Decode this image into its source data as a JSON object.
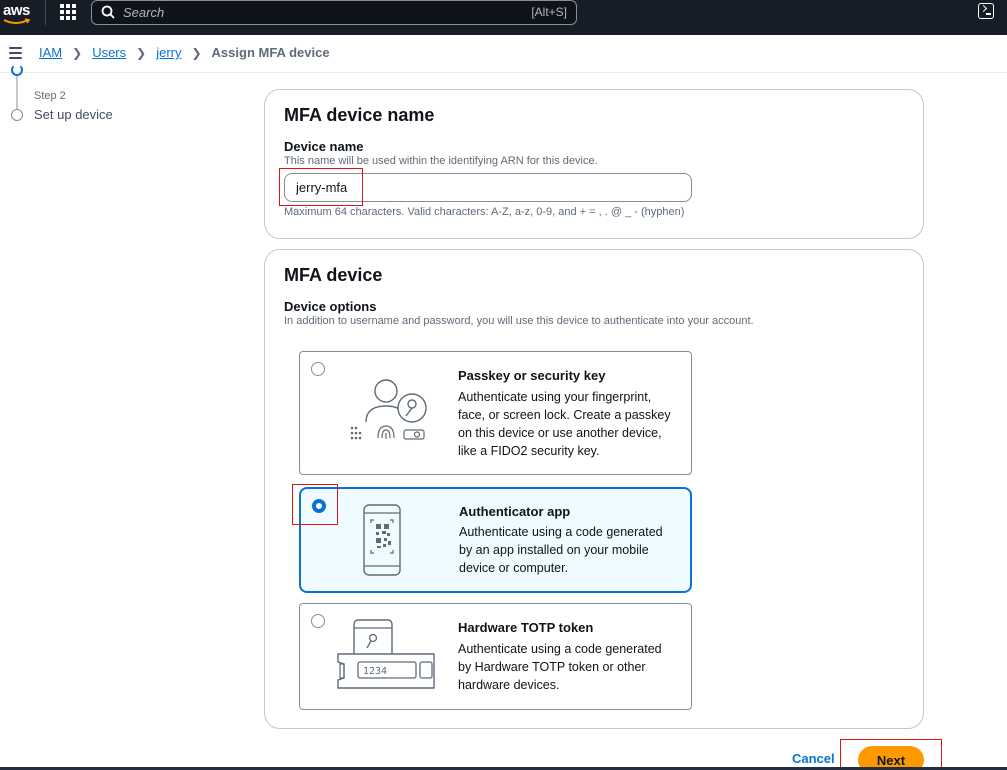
{
  "topnav": {
    "logo_text": "aws",
    "search_placeholder": "Search",
    "search_shortcut": "[Alt+S]"
  },
  "breadcrumb": {
    "items": [
      "IAM",
      "Users",
      "jerry"
    ],
    "current": "Assign MFA device"
  },
  "stepper": {
    "step_label": "Step 2",
    "step_title": "Set up device"
  },
  "device_name_section": {
    "title": "MFA device name",
    "field_label": "Device name",
    "field_description": "This name will be used within the identifying ARN for this device.",
    "field_value": "jerry-mfa",
    "constraint_text": "Maximum 64 characters. Valid characters: A-Z, a-z, 0-9, and + = , . @ _ - (hyphen)"
  },
  "mfa_device_section": {
    "title": "MFA device",
    "options_label": "Device options",
    "options_description": "In addition to username and password, you will use this device to authenticate into your account.",
    "options": [
      {
        "title": "Passkey or security key",
        "description": "Authenticate using your fingerprint, face, or screen lock. Create a passkey on this device or use another device, like a FIDO2 security key.",
        "selected": false,
        "icon": "passkey-illustration"
      },
      {
        "title": "Authenticator app",
        "description": "Authenticate using a code generated by an app installed on your mobile device or computer.",
        "selected": true,
        "icon": "authenticator-app-illustration"
      },
      {
        "title": "Hardware TOTP token",
        "description": "Authenticate using a code generated by Hardware TOTP token or other hardware devices.",
        "selected": false,
        "icon": "hardware-token-illustration",
        "token_display": "1234"
      }
    ]
  },
  "footer": {
    "cancel_label": "Cancel",
    "next_label": "Next"
  },
  "colors": {
    "accent_blue": "#0972d3",
    "primary_button": "#ff9900",
    "nav_bg": "#161d26",
    "highlight_red": "#d91515"
  }
}
